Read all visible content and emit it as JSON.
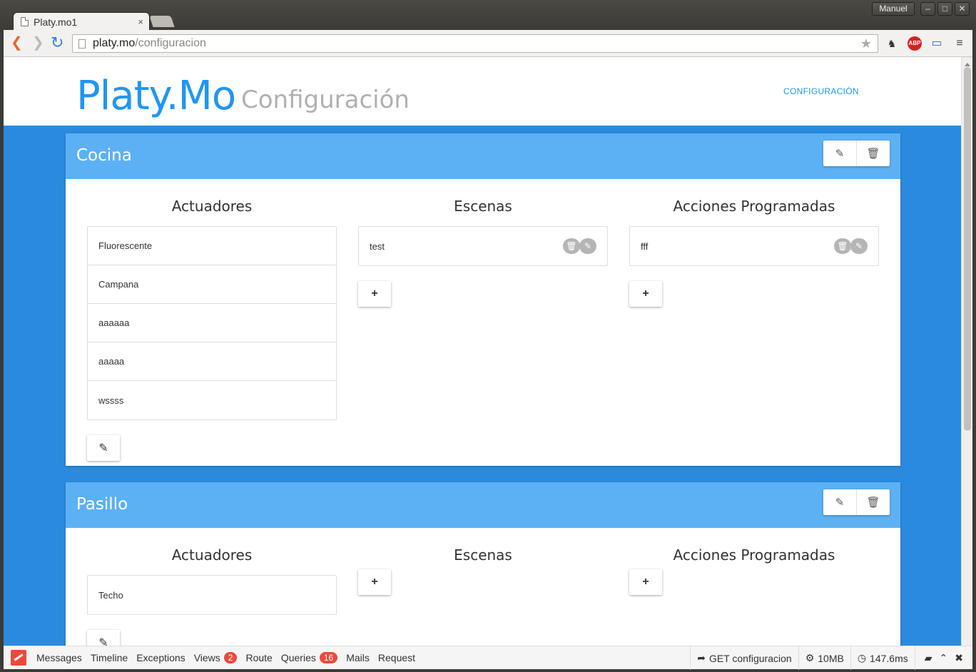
{
  "browser": {
    "tab_title": "Platy.mo1",
    "tab_close": "×",
    "user": "Manuel",
    "url_host": "platy.mo",
    "url_path": "/configuracion",
    "win_minimize": "–",
    "win_maximize": "□",
    "win_close": "✕",
    "icons": [
      "back-icon",
      "forward-icon",
      "reload-icon",
      "star-icon",
      "evernote-icon",
      "adblock-icon",
      "cast-icon",
      "menu-icon"
    ],
    "abp_label": "ABP"
  },
  "header": {
    "brand": "Platy.Mo",
    "subtitle": "Configuración",
    "nav_link": "CONFIGURACIÓN"
  },
  "rooms": [
    {
      "name": "Cocina",
      "actuadores_title": "Actuadores",
      "escenas_title": "Escenas",
      "acciones_title": "Acciones Programadas",
      "actuadores": [
        "Fluorescente",
        "Campana",
        "aaaaaa",
        "aaaaa",
        "wssss"
      ],
      "escenas": [
        "test"
      ],
      "acciones": [
        "fff"
      ]
    },
    {
      "name": "Pasillo",
      "actuadores_title": "Actuadores",
      "escenas_title": "Escenas",
      "acciones_title": "Acciones Programadas",
      "actuadores": [
        "Techo"
      ],
      "escenas": [],
      "acciones": []
    }
  ],
  "debugbar": {
    "tabs": {
      "messages": "Messages",
      "timeline": "Timeline",
      "exceptions": "Exceptions",
      "views": "Views",
      "views_count": "2",
      "route": "Route",
      "queries": "Queries",
      "queries_count": "16",
      "mails": "Mails",
      "request": "Request"
    },
    "route_info": "GET configuracion",
    "memory": "10MB",
    "time": "147.6ms"
  },
  "colors": {
    "brand_blue": "#2196f3",
    "page_bg": "#2a8bde",
    "room_header": "#5cb1f5",
    "badge_red": "#e84b3c"
  }
}
